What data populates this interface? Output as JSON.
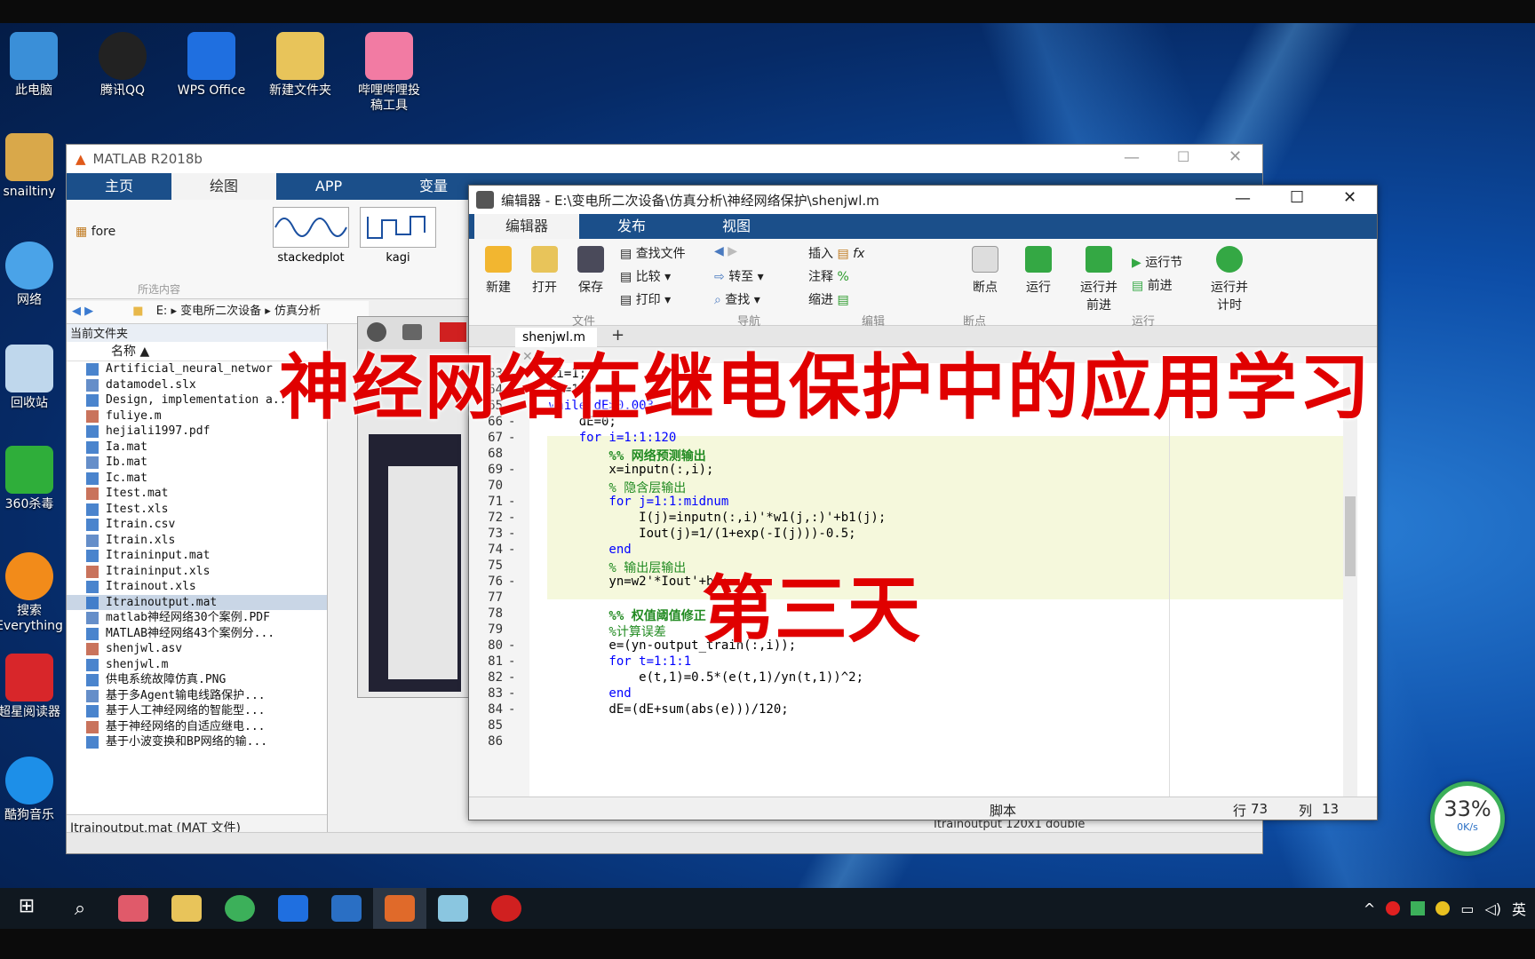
{
  "desktop": {
    "icons_top": [
      {
        "label": "此电脑",
        "color": "#3a8fd8"
      },
      {
        "label": "腾讯QQ",
        "color": "#222222"
      },
      {
        "label": "WPS Office",
        "color": "#1f6fe0"
      },
      {
        "label": "新建文件夹",
        "color": "#e8c45a"
      },
      {
        "label_line1": "哔哩哔哩投",
        "label_line2": "稿工具",
        "color": "#f27ba3"
      }
    ],
    "icons_left": [
      {
        "label": "snailtiny",
        "color": "#d9a84a"
      },
      {
        "label": "网络",
        "color": "#4aa3e8"
      },
      {
        "label": "回收站",
        "color": "#bfd7ec"
      },
      {
        "label": "360杀毒",
        "color": "#2fae3a"
      },
      {
        "label_line1": "搜索",
        "label_line2": "Everything",
        "color": "#f28b1a"
      },
      {
        "label": "超星阅读器",
        "color": "#d8262a"
      },
      {
        "label": "酷狗音乐",
        "color": "#1d8fe8"
      }
    ]
  },
  "matlab": {
    "title": "MATLAB R2018b",
    "tabs": [
      "主页",
      "绘图",
      "APP",
      "变量"
    ],
    "active_tab": "绘图",
    "var_label": "fore",
    "plots": [
      "stackedplot",
      "kagi"
    ],
    "section_label": "所选内容",
    "path": [
      "E:",
      "E:",
      "变电所二次设备",
      "仿真分析"
    ],
    "current_folder": "当前文件夹",
    "name_header": "名称 ▲",
    "files": [
      "Artificial_neural_networ",
      "datamodel.slx",
      "Design, implementation a..",
      "fuliye.m",
      "hejiali1997.pdf",
      "Ia.mat",
      "Ib.mat",
      "Ic.mat",
      "Itest.mat",
      "Itest.xls",
      "Itrain.csv",
      "Itrain.xls",
      "Itraininput.mat",
      "Itraininput.xls",
      "Itrainout.xls",
      "Itrainoutput.mat",
      "matlab神经网络30个案例.PDF",
      "MATLAB神经网络43个案例分...",
      "shenjwl.asv",
      "shenjwl.m",
      "供电系统故障仿真.PNG",
      "基于多Agent输电线路保护...",
      "基于人工神经网络的智能型...",
      "基于神经网络的自适应继电...",
      "基于小波变换和BP网络的输..."
    ],
    "selected_file": "Itrainoutput.mat  (MAT 文件)",
    "workspace_var": "Itrainoutput   120x1 double"
  },
  "editor": {
    "title": "编辑器 - E:\\变电所二次设备\\仿真分析\\神经网络保护\\shenjwl.m",
    "tabs": [
      "编辑器",
      "发布",
      "视图"
    ],
    "active_tab": "编辑器",
    "file_tab": "shenjwl.m",
    "ribbon": {
      "new": "新建",
      "open": "打开",
      "save": "保存",
      "find_file": "查找文件",
      "compare": "比较",
      "print": "打印",
      "goto": "转至",
      "find": "查找",
      "insert": "插入",
      "comment": "注释",
      "indent": "缩进",
      "breakpoint": "断点",
      "run": "运行",
      "run_advance": "运行并",
      "run_advance2": "前进",
      "run_section": "运行节",
      "advance": "前进",
      "run_time": "运行并",
      "run_time2": "计时",
      "sections": [
        "文件",
        "导航",
        "编辑",
        "断点",
        "运行"
      ]
    },
    "lines": [
      {
        "n": "63",
        "d": "-",
        "t": "ii=1;",
        "cls": ""
      },
      {
        "n": "64",
        "d": "-",
        "t": "dE=10;",
        "cls": ""
      },
      {
        "n": "65",
        "d": "-",
        "t": "while dE>0.003",
        "cls": "while"
      },
      {
        "n": "66",
        "d": "-",
        "t": "    dE=0;",
        "cls": ""
      },
      {
        "n": "67",
        "d": "-",
        "t": "    for i=1:1:120",
        "cls": "for"
      },
      {
        "n": "68",
        "d": "",
        "t": "        %% 网络预测输出",
        "cls": "cmb"
      },
      {
        "n": "69",
        "d": "-",
        "t": "        x=inputn(:,i);",
        "cls": ""
      },
      {
        "n": "70",
        "d": "",
        "t": "        % 隐含层输出",
        "cls": "cm"
      },
      {
        "n": "71",
        "d": "-",
        "t": "        for j=1:1:midnum",
        "cls": "for"
      },
      {
        "n": "72",
        "d": "-",
        "t": "            I(j)=inputn(:,i)'*w1(j,:)'+b1(j);",
        "cls": ""
      },
      {
        "n": "73",
        "d": "-",
        "t": "            Iout(j)=1/(1+exp(-I(j)))-0.5;",
        "cls": ""
      },
      {
        "n": "74",
        "d": "-",
        "t": "        end",
        "cls": "end"
      },
      {
        "n": "75",
        "d": "",
        "t": "        % 输出层输出",
        "cls": "cm"
      },
      {
        "n": "76",
        "d": "-",
        "t": "        yn=w2'*Iout'+b2;",
        "cls": ""
      },
      {
        "n": "77",
        "d": "",
        "t": "",
        "cls": ""
      },
      {
        "n": "78",
        "d": "",
        "t": "        %% 权值阈值修正",
        "cls": "cmb"
      },
      {
        "n": "79",
        "d": "",
        "t": "        %计算误差",
        "cls": "cm"
      },
      {
        "n": "80",
        "d": "-",
        "t": "        e=(yn-output_train(:,i));",
        "cls": ""
      },
      {
        "n": "81",
        "d": "-",
        "t": "        for t=1:1:1",
        "cls": "for"
      },
      {
        "n": "82",
        "d": "-",
        "t": "            e(t,1)=0.5*(e(t,1)/yn(t,1))^2;",
        "cls": ""
      },
      {
        "n": "83",
        "d": "-",
        "t": "        end",
        "cls": "end"
      },
      {
        "n": "84",
        "d": "-",
        "t": "        dE=(dE+sum(abs(e)))/120;",
        "cls": ""
      },
      {
        "n": "85",
        "d": "",
        "t": "",
        "cls": ""
      },
      {
        "n": "86",
        "d": "",
        "t": "",
        "cls": ""
      }
    ],
    "status": {
      "type": "脚本",
      "row_label": "行",
      "row": "73",
      "col_label": "列",
      "col": "13"
    }
  },
  "overlay": {
    "title": "神经网络在继电保护中的应用学习",
    "day": "第三天"
  },
  "network_widget": {
    "percent": "33%",
    "speed": "0K/s"
  },
  "taskbar": {
    "ime": "英"
  }
}
